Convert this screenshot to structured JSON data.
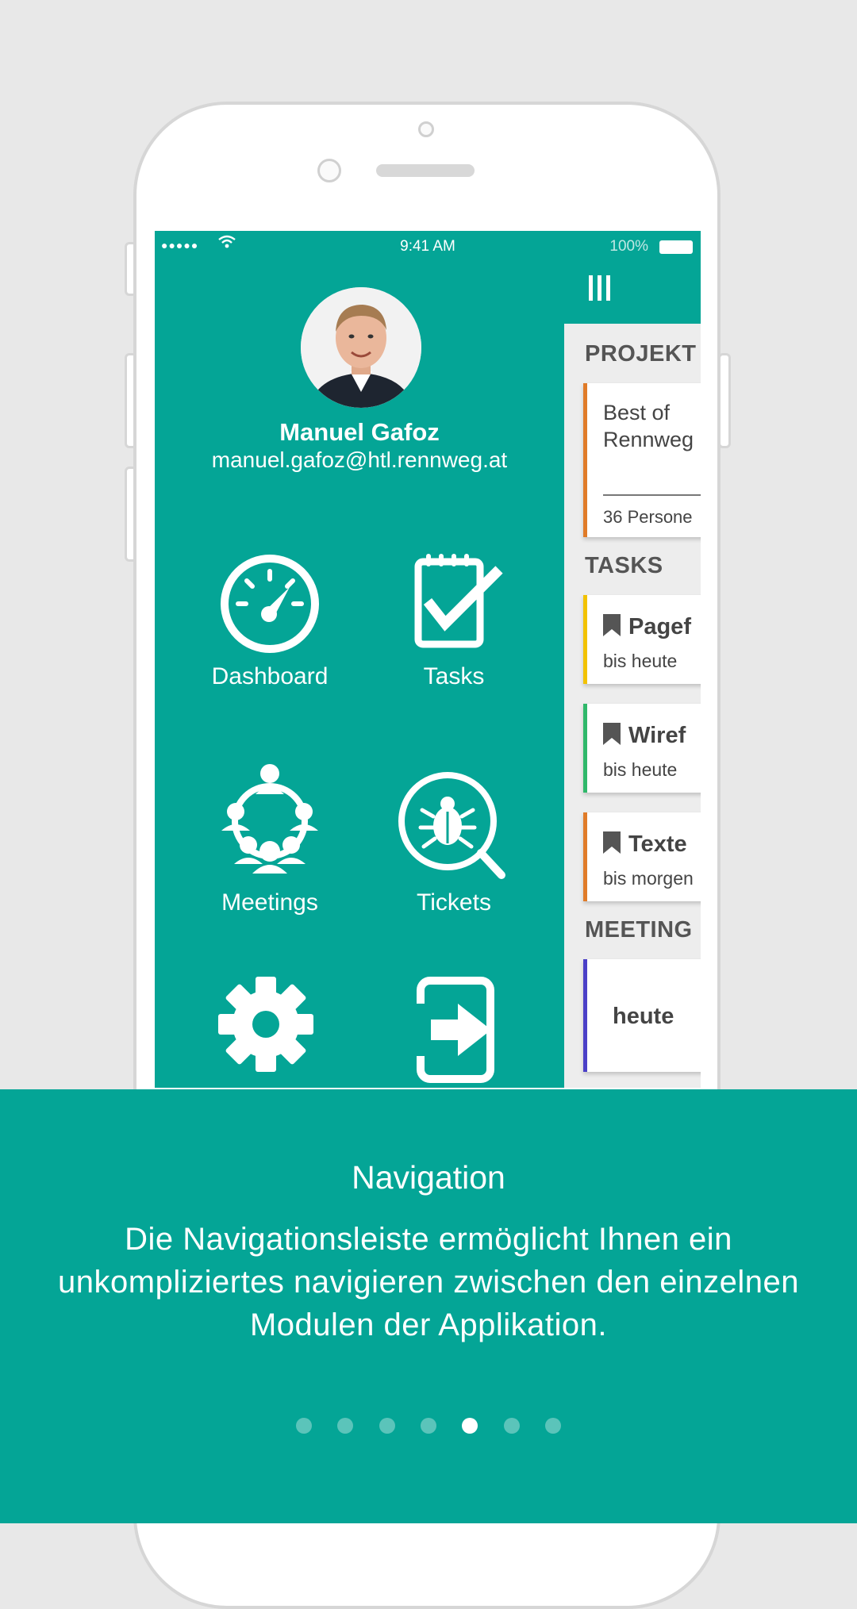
{
  "status_bar": {
    "signal": "●●●●●",
    "time": "9:41 AM",
    "battery": "100%"
  },
  "profile": {
    "name": "Manuel Gafoz",
    "email": "manuel.gafoz@htl.rennweg.at"
  },
  "nav": {
    "dashboard": "Dashboard",
    "tasks": "Tasks",
    "meetings": "Meetings",
    "tickets": "Tickets"
  },
  "panel": {
    "projects_title": "PROJEKT",
    "project_card": {
      "line1": "Best of",
      "line2": "Rennweg",
      "footer": "36 Persone",
      "accent": "#e07b28"
    },
    "tasks_title": "TASKS",
    "tasks": [
      {
        "title": "Pagef",
        "due": "bis heute",
        "accent": "#f2c200"
      },
      {
        "title": "Wiref",
        "due": "bis heute",
        "accent": "#2fb86a"
      },
      {
        "title": "Texte",
        "due": "bis morgen",
        "accent": "#e07b28"
      }
    ],
    "meetings_title": "MEETING",
    "meeting_card": {
      "label": "heute",
      "accent": "#4a3fc7"
    }
  },
  "onboarding": {
    "title": "Navigation",
    "text": "Die Navigationsleiste ermöglicht Ihnen ein unkompliziertes navigieren zwischen den einzelnen Modulen der Applikation.",
    "pages": 7,
    "active_page": 5
  },
  "colors": {
    "brand": "#04a596",
    "background": "#e8e8e8"
  }
}
